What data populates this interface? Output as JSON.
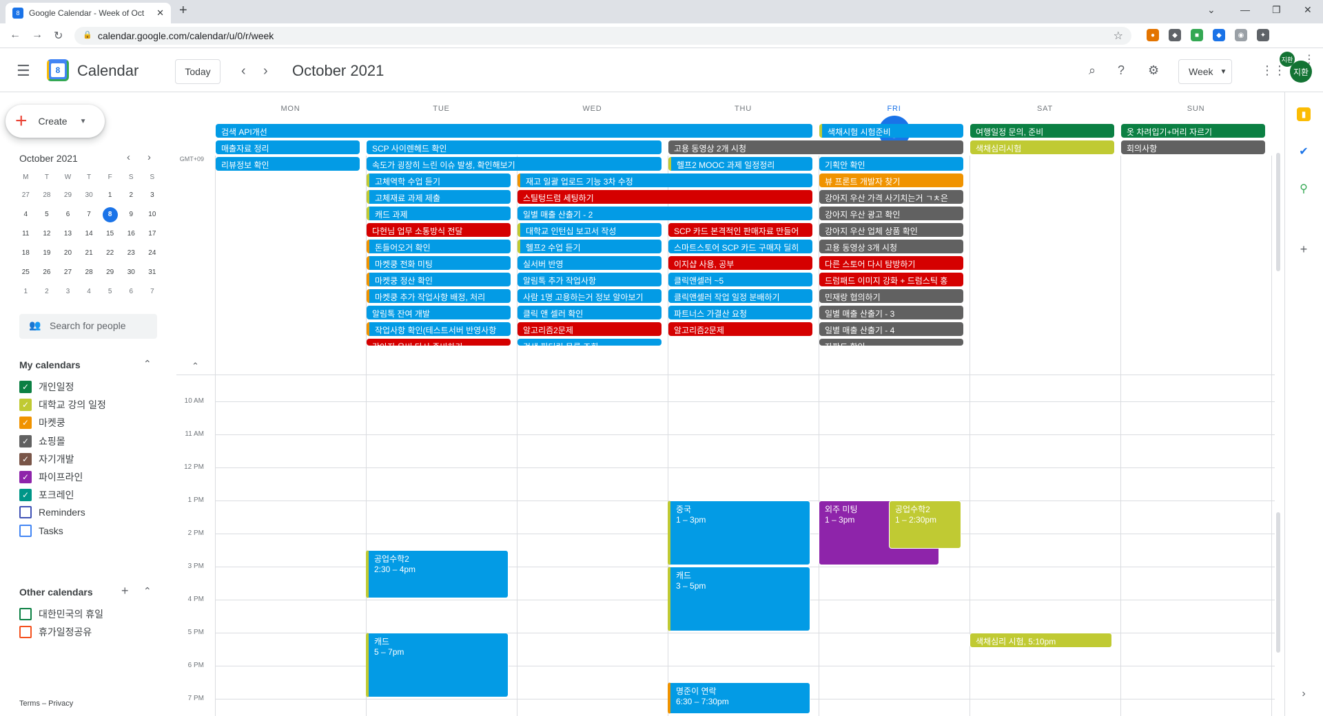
{
  "browser": {
    "tab_title": "Google Calendar - Week of Oct",
    "url": "calendar.google.com/calendar/u/0/r/week",
    "profile_initials": "지환"
  },
  "header": {
    "app_name": "Calendar",
    "logo_number": "8",
    "today_label": "Today",
    "month_title": "October 2021",
    "view_label": "Week",
    "avatar_initials": "지환"
  },
  "sidebar": {
    "create_label": "Create",
    "mini_cal": {
      "title": "October 2021",
      "day_headers": [
        "M",
        "T",
        "W",
        "T",
        "F",
        "S",
        "S"
      ],
      "weeks": [
        [
          "27",
          "28",
          "29",
          "30",
          "1",
          "2",
          "3"
        ],
        [
          "4",
          "5",
          "6",
          "7",
          "8",
          "9",
          "10"
        ],
        [
          "11",
          "12",
          "13",
          "14",
          "15",
          "16",
          "17"
        ],
        [
          "18",
          "19",
          "20",
          "21",
          "22",
          "23",
          "24"
        ],
        [
          "25",
          "26",
          "27",
          "28",
          "29",
          "30",
          "31"
        ],
        [
          "1",
          "2",
          "3",
          "4",
          "5",
          "6",
          "7"
        ]
      ],
      "today": "8"
    },
    "search_people": "Search for people",
    "my_calendars_title": "My calendars",
    "my_calendars": [
      {
        "label": "개인일정",
        "color": "#0b8043",
        "checked": true
      },
      {
        "label": "대학교 강의 일정",
        "color": "#c0ca33",
        "checked": true
      },
      {
        "label": "마켓쿵",
        "color": "#f09300",
        "checked": true
      },
      {
        "label": "쇼핑몰",
        "color": "#616161",
        "checked": true
      },
      {
        "label": "자기개발",
        "color": "#795548",
        "checked": true
      },
      {
        "label": "파이프라인",
        "color": "#8e24aa",
        "checked": true
      },
      {
        "label": "포크레인",
        "color": "#009688",
        "checked": true
      },
      {
        "label": "Reminders",
        "color": "#3f51b5",
        "checked": false
      },
      {
        "label": "Tasks",
        "color": "#4285f4",
        "checked": false
      }
    ],
    "other_calendars_title": "Other calendars",
    "other_calendars": [
      {
        "label": "대한민국의 휴일",
        "color": "#0b8043",
        "checked": false
      },
      {
        "label": "휴가일정공유",
        "color": "#f4511e",
        "checked": false
      }
    ],
    "footer": "Terms – Privacy"
  },
  "week": {
    "timezone": "GMT+09",
    "days": [
      {
        "dow": "MON",
        "dom": "4"
      },
      {
        "dow": "TUE",
        "dom": "5"
      },
      {
        "dow": "WED",
        "dom": "6"
      },
      {
        "dow": "THU",
        "dom": "7"
      },
      {
        "dow": "FRI",
        "dom": "8",
        "today": true
      },
      {
        "dow": "SAT",
        "dom": "9"
      },
      {
        "dow": "SUN",
        "dom": "10"
      }
    ],
    "hours": [
      "10 AM",
      "11 AM",
      "12 PM",
      "1 PM",
      "2 PM",
      "3 PM",
      "4 PM",
      "5 PM",
      "6 PM",
      "7 PM"
    ]
  },
  "colors": {
    "blue": "#039be5",
    "grey": "#616161",
    "red": "#d50000",
    "green": "#0b8043",
    "olive": "#c0ca33",
    "orange": "#f09300",
    "purple": "#8e24aa",
    "today_blue": "#1a73e8"
  },
  "allday_events": [
    {
      "title": "검색 API개선",
      "day": 0,
      "span": 4,
      "row": 0,
      "color": "blue"
    },
    {
      "title": "색채시험 시험준비",
      "day": 4,
      "span": 1,
      "row": 0,
      "color": "blue",
      "bar": "olive"
    },
    {
      "title": "여행일정 문의, 준비",
      "day": 5,
      "span": 1,
      "row": 0,
      "color": "green"
    },
    {
      "title": "옷 차려입기+머리 자르기",
      "day": 6,
      "span": 1,
      "row": 0,
      "color": "green"
    },
    {
      "title": "매출자료 정리",
      "day": 0,
      "span": 1,
      "row": 1,
      "color": "blue"
    },
    {
      "title": "SCP 사이렌헤드 확인",
      "day": 1,
      "span": 2,
      "row": 1,
      "color": "blue"
    },
    {
      "title": "고용 동영상 2개 시청",
      "day": 3,
      "span": 2,
      "row": 1,
      "color": "grey"
    },
    {
      "title": "색채심리시험",
      "day": 5,
      "span": 1,
      "row": 1,
      "color": "olive"
    },
    {
      "title": "회의사항",
      "day": 6,
      "span": 1,
      "row": 1,
      "color": "grey"
    },
    {
      "title": "리뷰정보 확인",
      "day": 0,
      "span": 1,
      "row": 2,
      "color": "blue"
    },
    {
      "title": "속도가 굉장히 느린 이슈 발생, 확인해보기",
      "day": 1,
      "span": 2,
      "row": 2,
      "color": "blue"
    },
    {
      "title": "헬프2 MOOC 과제 일정정리",
      "day": 3,
      "span": 1,
      "row": 2,
      "color": "blue",
      "bar": "olive"
    },
    {
      "title": "기획안 확인",
      "day": 4,
      "span": 1,
      "row": 2,
      "color": "blue"
    },
    {
      "title": "고체역학 수업 듣기",
      "day": 1,
      "span": 1,
      "row": 3,
      "color": "blue",
      "bar": "olive"
    },
    {
      "title": "재고 일괄 업로드 기능 3차 수정",
      "day": 2,
      "span": 2,
      "row": 3,
      "color": "blue",
      "bar": "orange"
    },
    {
      "title": "뷰 프론트 개발자 찾기",
      "day": 4,
      "span": 1,
      "row": 3,
      "color": "orange"
    },
    {
      "title": "고체재료 과제 제출",
      "day": 1,
      "span": 1,
      "row": 4,
      "color": "blue",
      "bar": "olive"
    },
    {
      "title": "스틸텅드럼 세팅하기",
      "day": 2,
      "span": 2,
      "row": 4,
      "color": "red"
    },
    {
      "title": "강아지 우산 가격 사기치는거 ㄱㅊ은",
      "day": 4,
      "span": 1,
      "row": 4,
      "color": "grey"
    },
    {
      "title": "캐드 과제",
      "day": 1,
      "span": 1,
      "row": 5,
      "color": "blue",
      "bar": "olive"
    },
    {
      "title": "일별 매출 산출기 - 2",
      "day": 2,
      "span": 2,
      "row": 5,
      "color": "blue"
    },
    {
      "title": "강아지 우산 광고 확인",
      "day": 4,
      "span": 1,
      "row": 5,
      "color": "grey"
    },
    {
      "title": "다현님 업무 소통방식 전달",
      "day": 1,
      "span": 1,
      "row": 6,
      "color": "red"
    },
    {
      "title": "대학교 인턴십 보고서 작성",
      "day": 2,
      "span": 1,
      "row": 6,
      "color": "blue",
      "bar": "olive"
    },
    {
      "title": "SCP 카드 본격적인 판매자료 만들어",
      "day": 3,
      "span": 1,
      "row": 6,
      "color": "red"
    },
    {
      "title": "강아지 우산 업체 상품 확인",
      "day": 4,
      "span": 1,
      "row": 6,
      "color": "grey"
    },
    {
      "title": "돈들어오거 확인",
      "day": 1,
      "span": 1,
      "row": 7,
      "color": "blue",
      "bar": "orange"
    },
    {
      "title": "헬프2 수업 듣기",
      "day": 2,
      "span": 1,
      "row": 7,
      "color": "blue",
      "bar": "olive"
    },
    {
      "title": "스마트스토어 SCP 카드 구매자 딜히",
      "day": 3,
      "span": 1,
      "row": 7,
      "color": "blue"
    },
    {
      "title": "고용 동영상 3개 시청",
      "day": 4,
      "span": 1,
      "row": 7,
      "color": "grey"
    },
    {
      "title": "마켓쿵 전화 미팅",
      "day": 1,
      "span": 1,
      "row": 8,
      "color": "blue",
      "bar": "orange"
    },
    {
      "title": "실서버 반영",
      "day": 2,
      "span": 1,
      "row": 8,
      "color": "blue"
    },
    {
      "title": "이지샵 사용, 공부",
      "day": 3,
      "span": 1,
      "row": 8,
      "color": "red"
    },
    {
      "title": "다른 스토어 다시 탐방하기",
      "day": 4,
      "span": 1,
      "row": 8,
      "color": "red"
    },
    {
      "title": "마켓쿵 정산 확인",
      "day": 1,
      "span": 1,
      "row": 9,
      "color": "blue",
      "bar": "orange"
    },
    {
      "title": "알림톡 추가 작업사항",
      "day": 2,
      "span": 1,
      "row": 9,
      "color": "blue"
    },
    {
      "title": "클릭앤셀러 ~5",
      "day": 3,
      "span": 1,
      "row": 9,
      "color": "blue"
    },
    {
      "title": "드럼패드 이미지 강화 + 드럼스틱 홍",
      "day": 4,
      "span": 1,
      "row": 9,
      "color": "red"
    },
    {
      "title": "마켓쿵 추가 작업사항 배정, 처리",
      "day": 1,
      "span": 1,
      "row": 10,
      "color": "blue",
      "bar": "orange"
    },
    {
      "title": "사람 1명 고용하는거 정보 알아보기",
      "day": 2,
      "span": 1,
      "row": 10,
      "color": "blue"
    },
    {
      "title": "클릭앤셀러 작업 일정 분배하기",
      "day": 3,
      "span": 1,
      "row": 10,
      "color": "blue"
    },
    {
      "title": "민재랑 협의하기",
      "day": 4,
      "span": 1,
      "row": 10,
      "color": "grey"
    },
    {
      "title": "알림톡 잔여 개발",
      "day": 1,
      "span": 1,
      "row": 11,
      "color": "blue"
    },
    {
      "title": "클릭 앤 셀러 확인",
      "day": 2,
      "span": 1,
      "row": 11,
      "color": "blue"
    },
    {
      "title": "파트너스 가결산 요청",
      "day": 3,
      "span": 1,
      "row": 11,
      "color": "blue"
    },
    {
      "title": "일별 매출 산출기 - 3",
      "day": 4,
      "span": 1,
      "row": 11,
      "color": "grey"
    },
    {
      "title": "작업사항 확인(테스트서버 반영사항",
      "day": 1,
      "span": 1,
      "row": 12,
      "color": "blue",
      "bar": "orange"
    },
    {
      "title": "알고리즘2문제",
      "day": 2,
      "span": 1,
      "row": 12,
      "color": "red"
    },
    {
      "title": "알고리즘2문제",
      "day": 3,
      "span": 1,
      "row": 12,
      "color": "red"
    },
    {
      "title": "일별 매출 산출기 - 4",
      "day": 4,
      "span": 1,
      "row": 12,
      "color": "grey"
    },
    {
      "title": "강아지 우비 다시 준비하기",
      "day": 1,
      "span": 1,
      "row": 13,
      "color": "red"
    },
    {
      "title": "검색 필터링 목록 조회",
      "day": 2,
      "span": 1,
      "row": 13,
      "color": "blue"
    },
    {
      "title": "자판도 확인",
      "day": 4,
      "span": 1,
      "row": 13,
      "color": "grey"
    }
  ],
  "timed_events": [
    {
      "title": "공업수학2",
      "time": "2:30 – 4pm",
      "day": 1,
      "start": 14.5,
      "end": 16,
      "color": "blue",
      "bar": "olive"
    },
    {
      "title": "캐드",
      "time": "5 – 7pm",
      "day": 1,
      "start": 17,
      "end": 19,
      "color": "blue",
      "bar": "olive"
    },
    {
      "title": "중국",
      "time": "1 – 3pm",
      "day": 3,
      "start": 13,
      "end": 15,
      "color": "blue",
      "bar": "olive"
    },
    {
      "title": "캐드",
      "time": "3 – 5pm",
      "day": 3,
      "start": 15,
      "end": 17,
      "color": "blue",
      "bar": "olive"
    },
    {
      "title": "명준이 연락",
      "time": "6:30 – 7:30pm",
      "day": 3,
      "start": 18.5,
      "end": 19.5,
      "color": "blue",
      "bar": "orange"
    },
    {
      "title": "외주 미팅",
      "time": "1 – 3pm",
      "day": 4,
      "start": 13,
      "end": 15,
      "color": "purple",
      "lane": 0
    },
    {
      "title": "공업수학2",
      "time": "1 – 2:30pm",
      "day": 4,
      "start": 13,
      "end": 14.5,
      "color": "olive",
      "lane": 1
    },
    {
      "title": "색채심리 시험, 5:10pm",
      "time": "",
      "day": 5,
      "start": 17,
      "end": 17.5,
      "color": "olive",
      "single": true
    }
  ]
}
